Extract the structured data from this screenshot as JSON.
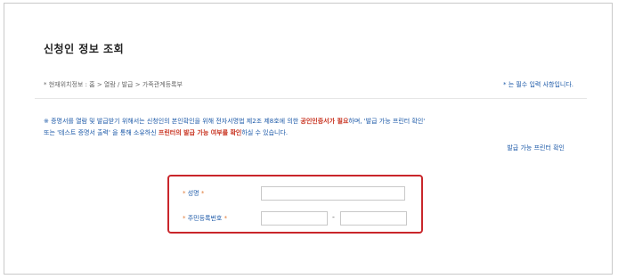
{
  "page": {
    "title": "신청인 정보 조회",
    "breadcrumb": "* 현재위치정보 : 홈 > 열람 / 발급 > 가족관계등록부",
    "required_note": "* 는 필수 입력 사항입니다."
  },
  "notice": {
    "part1": "※ 증명서를 열람 및 발급받기 위해서는 신청인의 본인확인을 위해 전자서명법 제2조 제8호에 의한 ",
    "part2": "공인인증서가 필요",
    "part3": "하며, '발급 가능 프린터 확인'",
    "part4": "또는 '테스트 증명서 출력' 을 통해 소유하신 ",
    "part5": "프린터의 발급 가능 여부를 확인",
    "part6": "하실 수 있습니다."
  },
  "printer_link": "발급 가능 프린터 확인",
  "form": {
    "name": {
      "star": "* ",
      "label": "성명",
      "star_after": " *",
      "value": ""
    },
    "rrn": {
      "star": "* ",
      "label": "주민등록번호",
      "star_after": " *",
      "front_value": "",
      "back_value": "",
      "separator": "-"
    }
  },
  "colors": {
    "accent_blue": "#1d5aa8",
    "alert_red": "#c8321f",
    "box_border": "#c9262b"
  }
}
